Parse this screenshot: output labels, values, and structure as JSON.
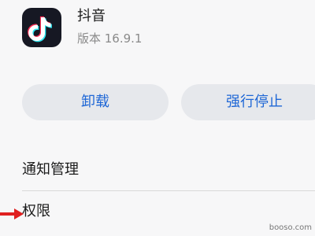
{
  "app": {
    "name": "抖音",
    "version": "版本 16.9.1",
    "icon": "tiktok-logo"
  },
  "actions": {
    "uninstall_label": "卸载",
    "force_stop_label": "强行停止",
    "accent_color": "#1f67d6"
  },
  "list": {
    "items": [
      {
        "label": "通知管理"
      },
      {
        "label": "权限"
      }
    ]
  },
  "annotation": {
    "arrow_color": "#e02020",
    "watermark": "booso.com"
  }
}
